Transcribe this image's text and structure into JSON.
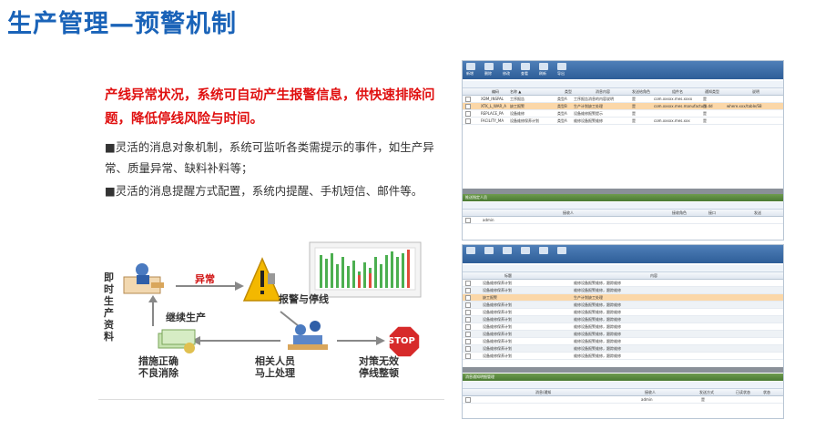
{
  "page": {
    "title": "生产管理—预警机制",
    "headline": "产线异常状况，系统可自动产生报警信息，供快速排除问题，降低停线风险与时间。",
    "bullets": [
      "■灵活的消息对象机制，系统可监听各类需提示的事件，如生产异常、质量异常、缺料补料等；",
      "■灵活的消息提醒方式配置，系统内提醒、手机短信、邮件等。"
    ]
  },
  "flow": {
    "left_vertical": "即时生产资料",
    "anomaly": "异常",
    "alarm_stop": "报警与停线",
    "continue": "继续生产",
    "fix": "措施正确\n不良消除",
    "handle": "相关人员\n马上处理",
    "invalid": "对策无效\n停线整顿",
    "stop_sign": "STOP"
  },
  "shot1": {
    "toolbar": [
      "新增",
      "删除",
      "修改",
      "查看",
      "刷新",
      "导出"
    ],
    "headers": [
      "编码",
      "名称 ▲",
      "类型",
      "消息内容",
      "发送给角色",
      "组件名",
      "通知类型",
      "说明"
    ],
    "rows": [
      [
        "XDM_INSPAL",
        "工序报告",
        "类型A",
        "工序报告消息的内容说明",
        "是",
        "com.xxxxx.mes.xxxx",
        "是",
        ""
      ],
      [
        "XTK_L_WAR_A",
        "缺工报警",
        "类型B",
        "生产计划缺工处理",
        "是",
        "com.xxxxx.mes.manufacture.dd",
        "是",
        "where.xxx/table/S8"
      ],
      [
        "REPLACE_PA",
        "设备维修",
        "类型A",
        "设备维修报警提示",
        "是",
        "",
        "是",
        ""
      ],
      [
        "FACILITY_MA",
        "设备维修保养计划",
        "类型A",
        "维修设备报警维修",
        "是",
        "com.xxxxx.mes.xxx",
        "是",
        ""
      ]
    ],
    "panel_title": "推送指定人员",
    "panel_headers": [
      "接收人",
      "接收角色",
      "接口",
      "发送"
    ],
    "panel_rows": [
      [
        "admin",
        "",
        "",
        ""
      ]
    ]
  },
  "shot2": {
    "headers": [
      "标题",
      "内容"
    ],
    "rows": [
      [
        "设备维修保养计划",
        "维修设备报警维修，跟踪维修"
      ],
      [
        "设备维修保养计划",
        "维修设备报警维修，跟踪维修"
      ],
      [
        "缺工报警",
        "生产计划缺工处理"
      ],
      [
        "设备维修保养计划",
        "维修设备报警维修，跟踪维修"
      ],
      [
        "设备维修保养计划",
        "维修设备报警维修，跟踪维修"
      ],
      [
        "设备维修保养计划",
        "维修设备报警维修，跟踪维修"
      ],
      [
        "设备维修保养计划",
        "维修设备报警维修，跟踪维修"
      ],
      [
        "设备维修保养计划",
        "维修设备报警维修，跟踪维修"
      ],
      [
        "设备维修保养计划",
        "维修设备报警维修，跟踪维修"
      ],
      [
        "设备维修保养计划",
        "维修设备报警维修，跟踪维修"
      ],
      [
        "设备维修保养计划",
        "维修设备报警维修，跟踪维修"
      ]
    ],
    "panel_title": "消息通知明细管理",
    "panel_headers": [
      "消息/通知",
      "接收人",
      "发送方式",
      "已读状态",
      "状态"
    ],
    "panel_rows": [
      [
        "",
        "admin",
        "",
        "是",
        ""
      ]
    ]
  },
  "colors": {
    "title": "#1a63b8",
    "headline": "#e01010",
    "selected_row": "#fbd7a8",
    "toolbar": "#2e5e98"
  }
}
